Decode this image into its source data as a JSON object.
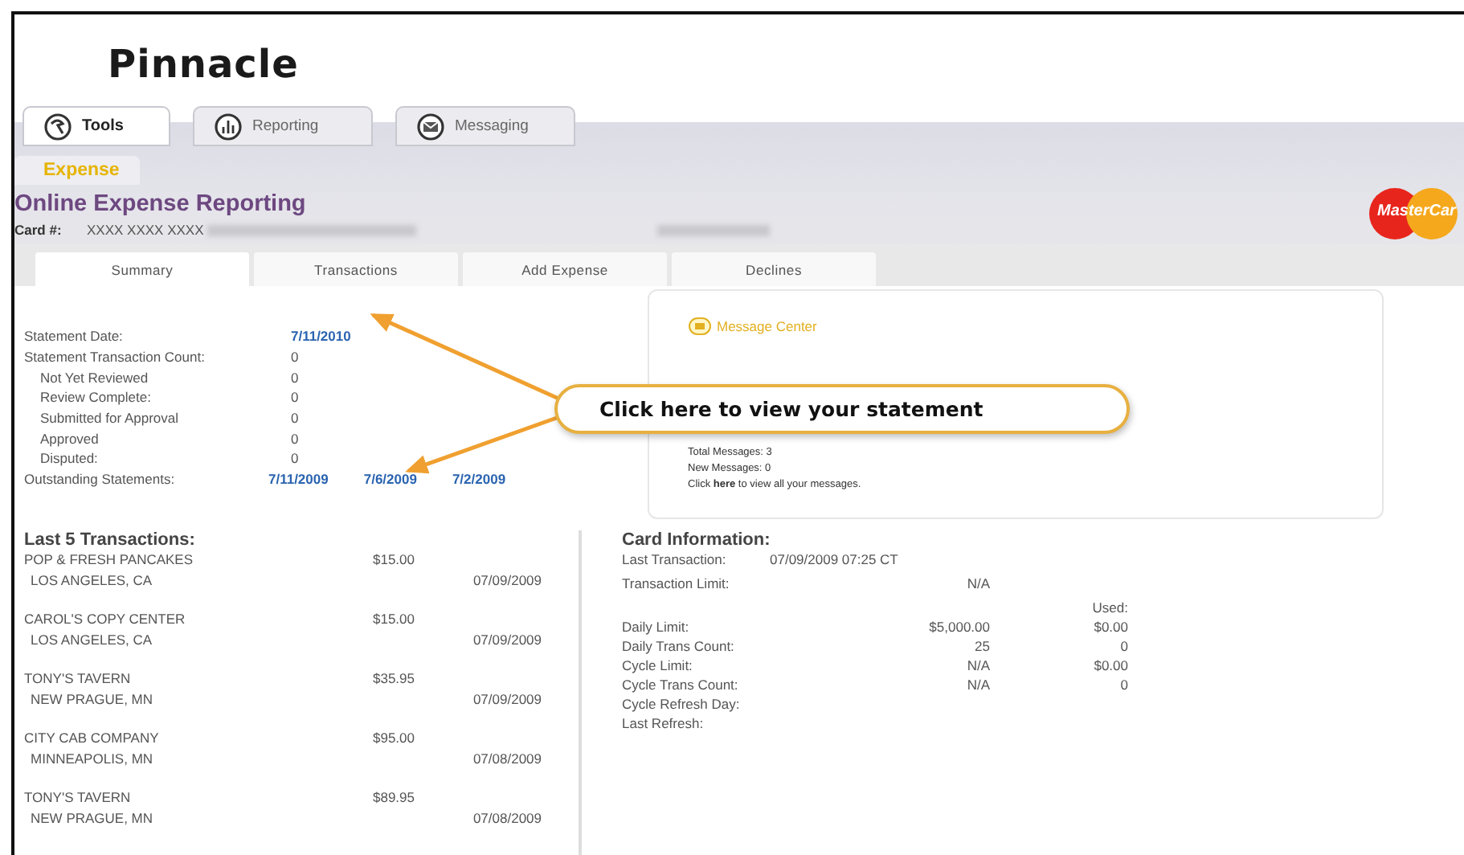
{
  "logo": {
    "text": "Pinnacle"
  },
  "nav_tabs": [
    {
      "label": "Tools",
      "kind": "tools",
      "selected": true
    },
    {
      "label": "Reporting",
      "kind": "chart",
      "selected": false
    },
    {
      "label": "Messaging",
      "kind": "mail",
      "selected": false
    }
  ],
  "section_tab": {
    "label": "Expense"
  },
  "title": "Online Expense Reporting",
  "card": {
    "label": "Card #:",
    "number": "XXXX XXXX XXXX"
  },
  "card_brand": {
    "text": "MasterCar"
  },
  "sub_tabs": [
    {
      "label": "Summary",
      "selected": true
    },
    {
      "label": "Transactions",
      "selected": false
    },
    {
      "label": "Add Expense",
      "selected": false
    },
    {
      "label": "Declines",
      "selected": false
    }
  ],
  "statement": [
    {
      "label": "Statement Date:",
      "value": "7/11/2010",
      "kind": "link"
    },
    {
      "label": "Statement Transaction Count:",
      "value": "0",
      "kind": "text",
      "children": [
        {
          "label": "Not Yet Reviewed",
          "value": "0",
          "kind": "text"
        },
        {
          "label": "Review Complete:",
          "value": "0",
          "kind": "text"
        },
        {
          "label": "Submitted for Approval",
          "value": "0",
          "kind": "text"
        },
        {
          "label": "Approved",
          "value": "0",
          "kind": "text"
        },
        {
          "label": "Disputed:",
          "value": "0",
          "kind": "text"
        }
      ]
    }
  ],
  "outstanding": {
    "label": "Outstanding Statements:",
    "links": [
      "7/11/2009",
      "7/6/2009",
      "7/2/2009"
    ]
  },
  "message_center": {
    "title": "Message Center",
    "lines": [
      "Total Messages: 3",
      "New Messages: 0"
    ],
    "note": "Click **here** to view all your messages."
  },
  "callout": {
    "text": "Click here to view your statement"
  },
  "transactions": {
    "title": "Last 5 Transactions:",
    "items": [
      {
        "merchant": "POP & FRESH PANCAKES",
        "amount": "$15.00",
        "location": "LOS ANGELES, CA",
        "date": "07/09/2009"
      },
      {
        "merchant": "CAROL'S COPY CENTER",
        "amount": "$15.00",
        "location": "LOS ANGELES, CA",
        "date": "07/09/2009"
      },
      {
        "merchant": "TONY'S TAVERN",
        "amount": "$35.95",
        "location": "NEW PRAGUE, MN",
        "date": "07/09/2009"
      },
      {
        "merchant": "CITY CAB COMPANY",
        "amount": "$95.00",
        "location": "MINNEAPOLIS, MN",
        "date": "07/08/2009"
      },
      {
        "merchant": "TONY'S TAVERN",
        "amount": "$89.95",
        "location": "NEW PRAGUE, MN",
        "date": "07/08/2009"
      }
    ]
  },
  "card_info": {
    "title": "Card Information:",
    "last_transaction": {
      "label": "Last Transaction:",
      "value": "07/09/2009 07:25 CT"
    },
    "transaction_limit": {
      "label": "Transaction Limit:",
      "value": "N/A"
    },
    "used_header": "Used:",
    "rows": [
      {
        "label": "Daily Limit:",
        "limit": "$5,000.00",
        "used": "$0.00"
      },
      {
        "label": "Daily Trans Count:",
        "limit": "25",
        "used": "0"
      },
      {
        "label": "Cycle Limit:",
        "limit": "N/A",
        "used": "$0.00"
      },
      {
        "label": "Cycle Trans Count:",
        "limit": "N/A",
        "used": "0"
      }
    ],
    "extra": [
      "Cycle Refresh Day:",
      "Last Refresh:"
    ]
  }
}
